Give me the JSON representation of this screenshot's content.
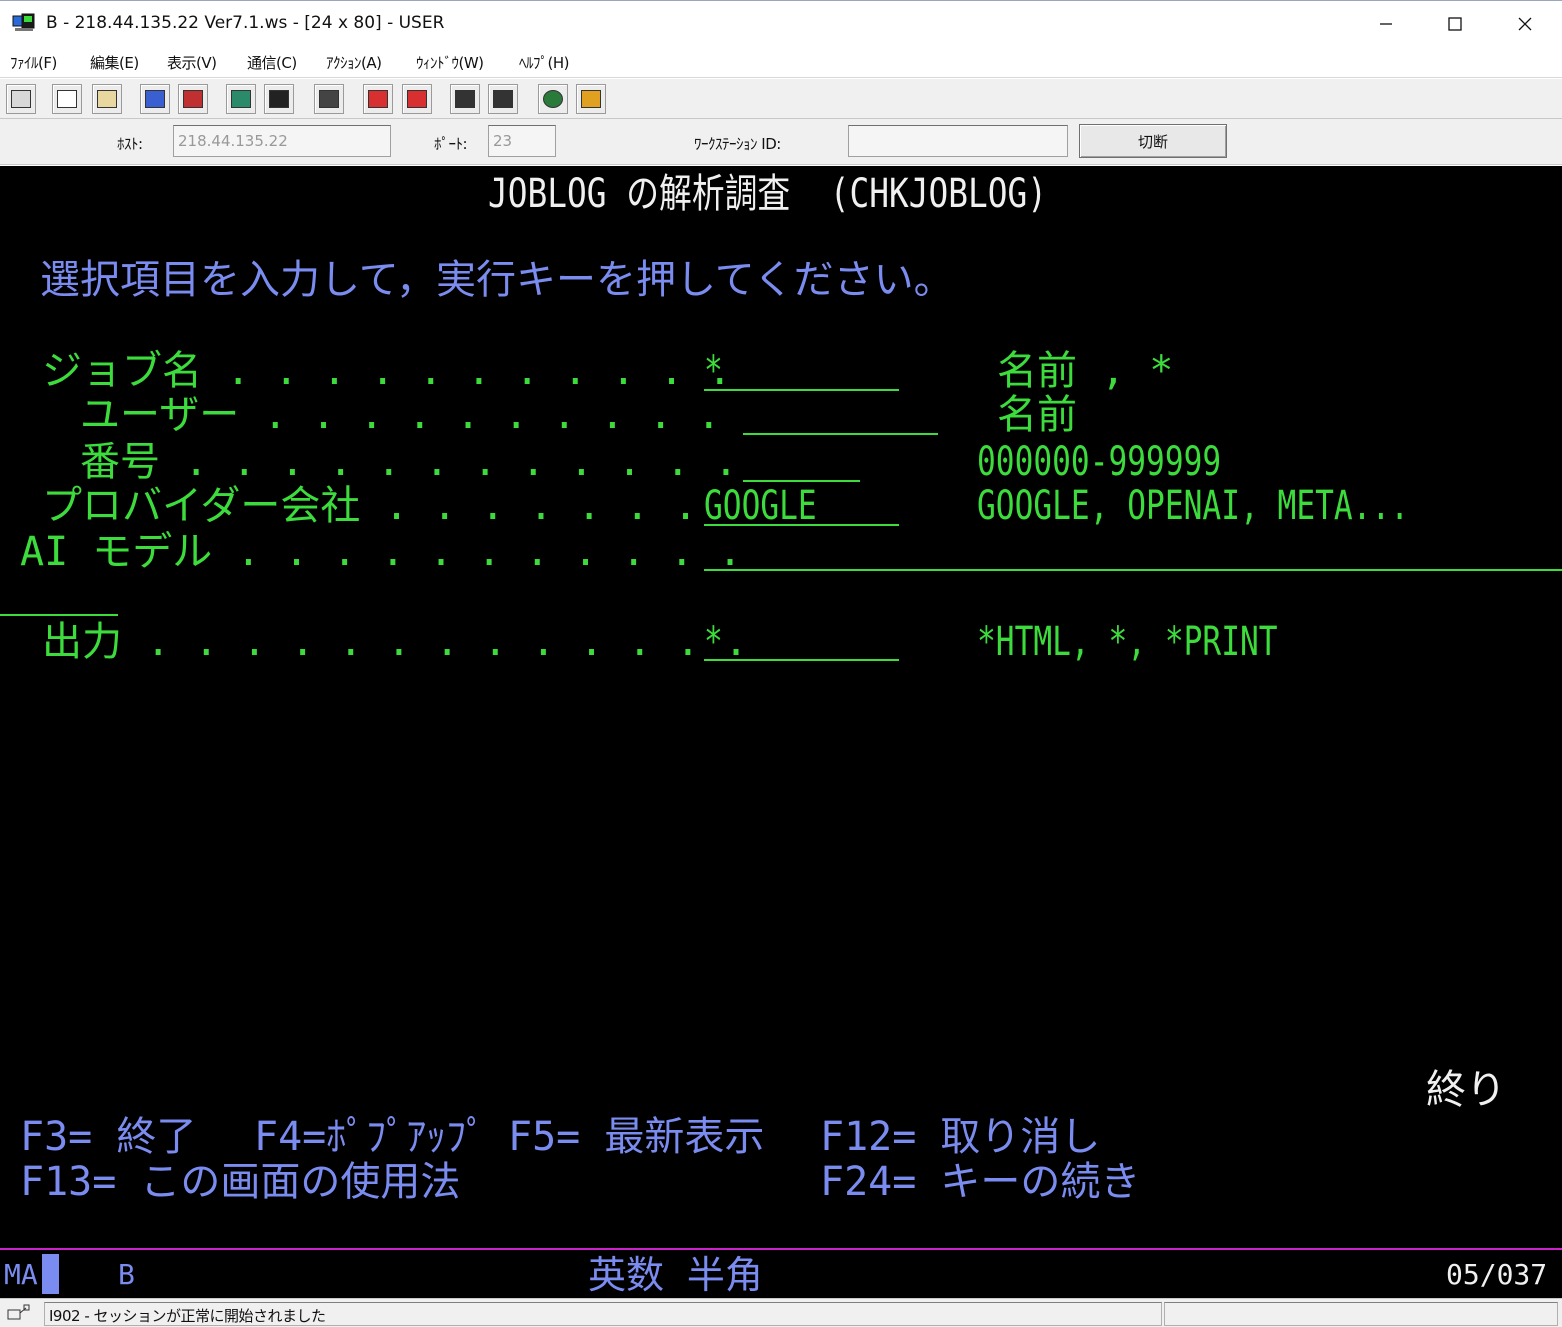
{
  "window": {
    "title": "B - 218.44.135.22 Ver7.1.ws - [24 x 80] - USER",
    "icon": "terminal-app-icon"
  },
  "menu": [
    {
      "label": "ﾌｧｲﾙ(F)"
    },
    {
      "label": "編集(E)"
    },
    {
      "label": "表示(V)"
    },
    {
      "label": "通信(C)"
    },
    {
      "label": "ｱｸｼｮﾝ(A)"
    },
    {
      "label": "ｳｨﾝﾄﾞｳ(W)"
    },
    {
      "label": "ﾍﾙﾌﾟ(H)"
    }
  ],
  "connection": {
    "host_label": "ﾎｽﾄ:",
    "host_value": "218.44.135.22",
    "port_label": "ﾎﾟｰﾄ:",
    "port_value": "23",
    "ws_label": "ﾜｰｸｽﾃｰｼｮﾝ ID:",
    "ws_value": "",
    "disconnect_label": "切断"
  },
  "screen": {
    "title": "JOBLOG の解析調査  (CHKJOBLOG)",
    "instruction": "選択項目を入力して，実行キーを押してください。",
    "fields": {
      "job_name": {
        "label": "ジョブ名 . . . . . . . . . . .",
        "value": "*",
        "hint": "名前 , *"
      },
      "user": {
        "label": "ユーザー . . . . . . . . . .",
        "value": "",
        "hint": "名前"
      },
      "number": {
        "label": "番号 . . . . . . . . . . . .",
        "value": "",
        "hint": "000000-999999"
      },
      "provider": {
        "label": "プロバイダー会社 . . . . . . .",
        "value": "GOOGLE",
        "hint": "GOOGLE, OPENAI, META..."
      },
      "ai_model": {
        "label": "AI モデル . . . . . . . . . . .",
        "value": ""
      },
      "output": {
        "label": "出力 . . . . . . . . . . . . .",
        "value": "*",
        "hint": "*HTML, *, *PRINT"
      }
    },
    "more": "終り",
    "function_keys": {
      "f3": "F3= 終了",
      "f4": "F4=ﾎﾟﾌﾟｱｯﾌﾟ",
      "f5": "F5= 最新表示",
      "f12": "F12= 取り消し",
      "f13": "F13= この画面の使用法",
      "f24": "F24= キーの続き"
    },
    "status_row": {
      "mode": "MA",
      "session": "B",
      "input_mode": "英数 半角",
      "cursor_pos": "05/037"
    }
  },
  "statusbar": {
    "message": "I902 - セッションが正常に開始されました"
  },
  "colors": {
    "terminal_bg": "#000000",
    "field_green": "#3ddc3d",
    "text_blue": "#7b8cf0",
    "status_line": "#cc22cc"
  }
}
